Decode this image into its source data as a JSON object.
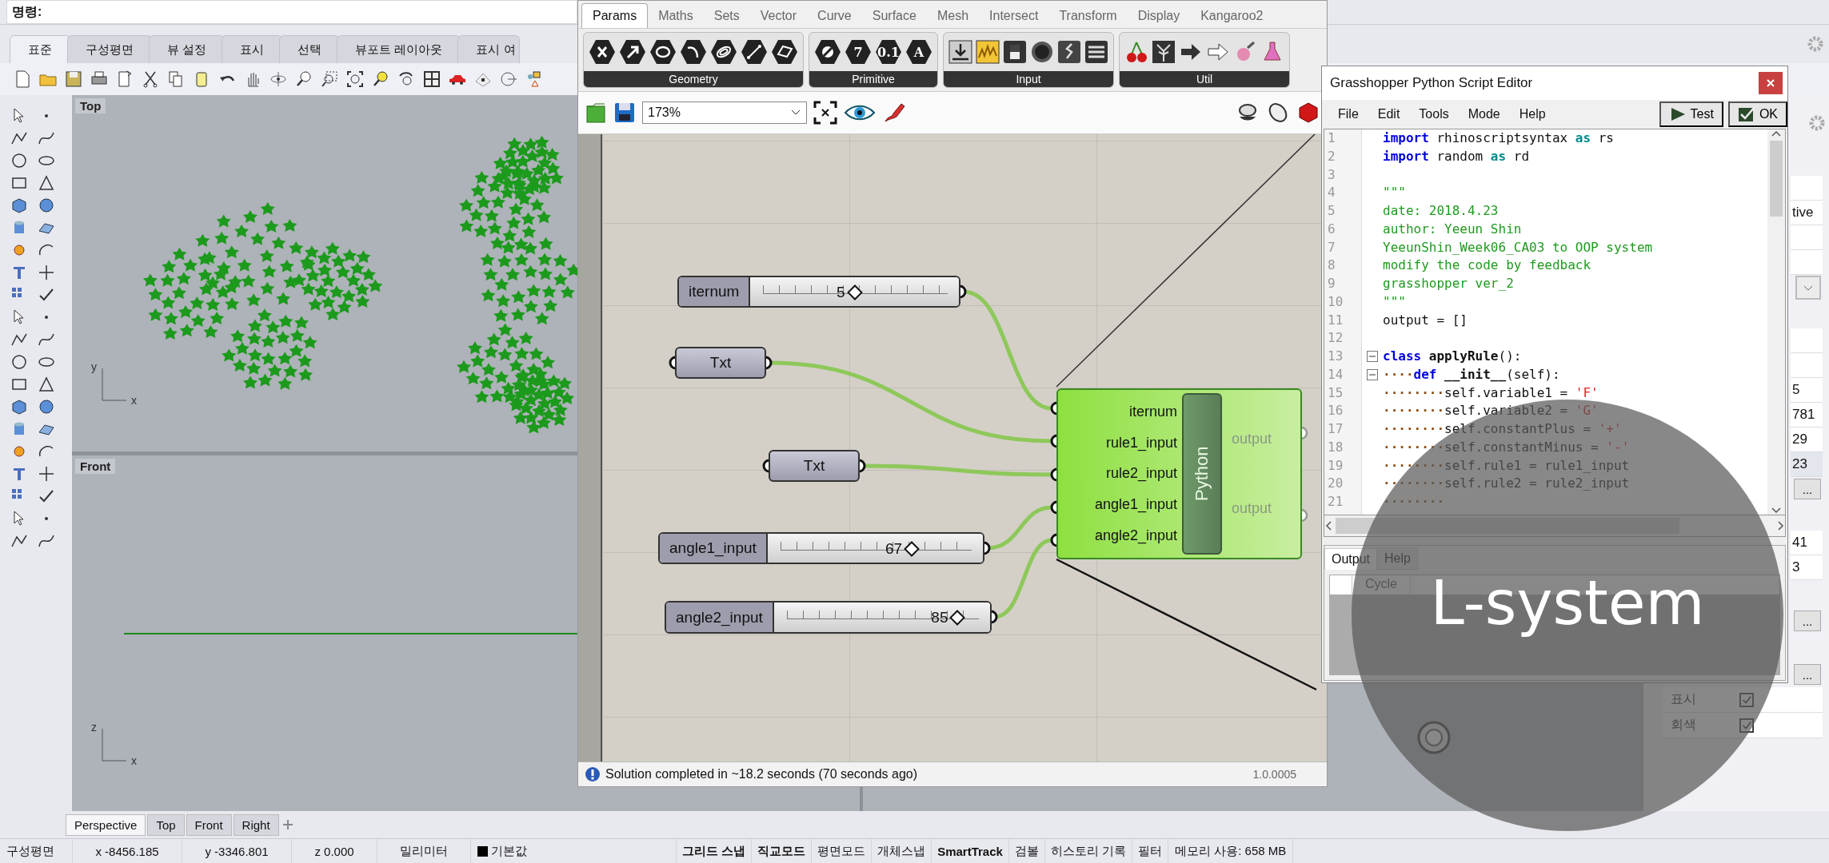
{
  "command_line": {
    "prompt": "명령:"
  },
  "toolbar_tabs": [
    {
      "label": "표준",
      "selected": true
    },
    {
      "label": "구성평면",
      "selected": false
    },
    {
      "label": "뷰 설정",
      "selected": false
    },
    {
      "label": "표시",
      "selected": false
    },
    {
      "label": "선택",
      "selected": false
    },
    {
      "label": "뷰포트 레이아웃",
      "selected": false
    },
    {
      "label": "표시 여",
      "selected": false
    }
  ],
  "viewports": [
    {
      "title": "Top",
      "axes": [
        "y",
        "x"
      ]
    },
    {
      "title": "Front",
      "axes": [
        "z",
        "x"
      ]
    }
  ],
  "viewport_tabs": [
    {
      "label": "Perspective",
      "selected": true
    },
    {
      "label": "Top",
      "selected": false
    },
    {
      "label": "Front",
      "selected": false
    },
    {
      "label": "Right",
      "selected": false
    }
  ],
  "status_bar": {
    "cplane": "구성평면",
    "x": "x -8456.185",
    "y": "y -3346.801",
    "z": "z 0.000",
    "units": "밀리미터",
    "layer": "기본값",
    "toggles": [
      {
        "label": "그리드 스냅",
        "on": true
      },
      {
        "label": "직교모드",
        "on": true
      },
      {
        "label": "평면모드",
        "on": false
      },
      {
        "label": "개체스냅",
        "on": false
      },
      {
        "label": "SmartTrack",
        "on": true
      },
      {
        "label": "검볼",
        "on": false
      },
      {
        "label": "히스토리 기록",
        "on": false
      },
      {
        "label": "필터",
        "on": false
      }
    ],
    "memory": "메모리 사용: 658 MB"
  },
  "properties_panel": {
    "rows": [
      {
        "kind": "blank"
      },
      {
        "kind": "value",
        "value": "tive",
        "selected": false
      },
      {
        "kind": "blank"
      },
      {
        "kind": "blank"
      },
      {
        "kind": "dropdown"
      },
      {
        "kind": "section"
      },
      {
        "kind": "blank"
      },
      {
        "kind": "blank"
      },
      {
        "kind": "value",
        "value": "5",
        "selected": false
      },
      {
        "kind": "value",
        "value": "781",
        "selected": false
      },
      {
        "kind": "value",
        "value": "29",
        "selected": false
      },
      {
        "kind": "value",
        "value": "23",
        "selected": true
      },
      {
        "kind": "button",
        "label": "..."
      },
      {
        "kind": "section"
      },
      {
        "kind": "value",
        "value": "41",
        "selected": false
      },
      {
        "kind": "value",
        "value": "3",
        "selected": false
      },
      {
        "kind": "section"
      },
      {
        "kind": "button",
        "label": "..."
      },
      {
        "kind": "section"
      },
      {
        "kind": "button",
        "label": "..."
      },
      {
        "kind": "check",
        "label": "표시",
        "checked": true
      },
      {
        "kind": "check",
        "label": "회색",
        "checked": true
      }
    ]
  },
  "grasshopper": {
    "tabs": [
      {
        "label": "Params",
        "selected": true
      },
      {
        "label": "Maths",
        "selected": false
      },
      {
        "label": "Sets",
        "selected": false
      },
      {
        "label": "Vector",
        "selected": false
      },
      {
        "label": "Curve",
        "selected": false
      },
      {
        "label": "Surface",
        "selected": false
      },
      {
        "label": "Mesh",
        "selected": false
      },
      {
        "label": "Intersect",
        "selected": false
      },
      {
        "label": "Transform",
        "selected": false
      },
      {
        "label": "Display",
        "selected": false
      },
      {
        "label": "Kangaroo2",
        "selected": false
      }
    ],
    "ribbon_groups": [
      {
        "title": "Geometry"
      },
      {
        "title": "Primitive",
        "glyphs": [
          "7",
          "0.1",
          "A"
        ]
      },
      {
        "title": "Input"
      },
      {
        "title": "Util"
      }
    ],
    "zoom": "173%",
    "sliders": [
      {
        "label": "iternum",
        "value": "5",
        "level": 0.5
      },
      {
        "label": "angle1_input",
        "value": "67",
        "level": 0.67
      },
      {
        "label": "angle2_input",
        "value": "85",
        "level": 0.85
      }
    ],
    "panels": [
      {
        "label": "Txt"
      },
      {
        "label": "Txt"
      }
    ],
    "component": {
      "title": "Python",
      "inputs": [
        "iternum",
        "rule1_input",
        "rule2_input",
        "angle1_input",
        "angle2_input"
      ],
      "outputs": [
        "output",
        "output"
      ]
    },
    "status": "Solution completed in ~18.2 seconds (70 seconds ago)",
    "version": "1.0.0005"
  },
  "script_editor": {
    "title": "Grasshopper Python Script Editor",
    "menu": [
      "File",
      "Edit",
      "Tools",
      "Mode",
      "Help"
    ],
    "buttons": [
      "Test",
      "OK"
    ],
    "code_lines": [
      {
        "number": "1",
        "fold": false,
        "tokens": [
          {
            "kind": "keyword",
            "text": "import"
          },
          {
            "kind": "plain",
            "text": " rhinoscriptsyntax "
          },
          {
            "kind": "operator",
            "text": "as"
          },
          {
            "kind": "plain",
            "text": " rs"
          }
        ]
      },
      {
        "number": "2",
        "fold": false,
        "tokens": [
          {
            "kind": "keyword",
            "text": "import"
          },
          {
            "kind": "plain",
            "text": " random "
          },
          {
            "kind": "operator",
            "text": "as"
          },
          {
            "kind": "plain",
            "text": " rd"
          }
        ]
      },
      {
        "number": "3",
        "fold": false
      },
      {
        "number": "4",
        "fold": false,
        "tokens": [
          {
            "kind": "docstring",
            "text": "\"\"\""
          }
        ]
      },
      {
        "number": "5",
        "fold": false,
        "tokens": [
          {
            "kind": "docstring",
            "text": "date: 2018.4.23"
          }
        ]
      },
      {
        "number": "6",
        "fold": false,
        "tokens": [
          {
            "kind": "docstring",
            "text": "author: Yeeun Shin"
          }
        ]
      },
      {
        "number": "7",
        "fold": false,
        "tokens": [
          {
            "kind": "docstring",
            "text": "YeeunShin_Week06_CA03 to OOP system"
          }
        ]
      },
      {
        "number": "8",
        "fold": false,
        "tokens": [
          {
            "kind": "docstring",
            "text": "modify the code by feedback"
          }
        ]
      },
      {
        "number": "9",
        "fold": false,
        "tokens": [
          {
            "kind": "docstring",
            "text": "grasshopper ver_2"
          }
        ]
      },
      {
        "number": "10",
        "fold": false,
        "tokens": [
          {
            "kind": "docstring",
            "text": "\"\"\""
          }
        ]
      },
      {
        "number": "11",
        "fold": false,
        "tokens": [
          {
            "kind": "plain",
            "text": "output = []"
          }
        ]
      },
      {
        "number": "12",
        "fold": false
      },
      {
        "number": "13",
        "fold": true,
        "tokens": [
          {
            "kind": "keyword",
            "text": "class"
          },
          {
            "kind": "name",
            "text": " applyRule"
          },
          {
            "kind": "plain",
            "text": "():"
          }
        ]
      },
      {
        "number": "14",
        "fold": true,
        "tokens": [
          {
            "kind": "whitespace",
            "text": "····"
          },
          {
            "kind": "keyword",
            "text": "def"
          },
          {
            "kind": "name",
            "text": " __init__"
          },
          {
            "kind": "plain",
            "text": "(self):"
          }
        ]
      },
      {
        "number": "15",
        "fold": false,
        "tokens": [
          {
            "kind": "whitespace",
            "text": "········"
          },
          {
            "kind": "plain",
            "text": "self.variable1 = "
          },
          {
            "kind": "string",
            "text": "'F'"
          }
        ]
      },
      {
        "number": "16",
        "fold": false,
        "tokens": [
          {
            "kind": "whitespace",
            "text": "········"
          },
          {
            "kind": "plain",
            "text": "self.variable2 = "
          },
          {
            "kind": "string",
            "text": "'G'"
          }
        ]
      },
      {
        "number": "17",
        "fold": false,
        "tokens": [
          {
            "kind": "whitespace",
            "text": "········"
          },
          {
            "kind": "plain",
            "text": "self.constantPlus = "
          },
          {
            "kind": "string",
            "text": "'+'"
          }
        ]
      },
      {
        "number": "18",
        "fold": false,
        "tokens": [
          {
            "kind": "whitespace",
            "text": "········"
          },
          {
            "kind": "plain",
            "text": "self.constantMinus = "
          },
          {
            "kind": "string",
            "text": "'-'"
          }
        ]
      },
      {
        "number": "19",
        "fold": false,
        "tokens": [
          {
            "kind": "whitespace",
            "text": "········"
          },
          {
            "kind": "plain",
            "text": "self.rule1 = rule1_input"
          }
        ]
      },
      {
        "number": "20",
        "fold": false,
        "tokens": [
          {
            "kind": "whitespace",
            "text": "········"
          },
          {
            "kind": "plain",
            "text": "self.rule2 = rule2_input"
          }
        ]
      },
      {
        "number": "21",
        "fold": false,
        "tokens": [
          {
            "kind": "whitespace",
            "text": "········"
          }
        ]
      }
    ],
    "output_tabs": [
      {
        "label": "Output",
        "selected": true
      },
      {
        "label": "Help",
        "selected": false
      }
    ],
    "output_columns": [
      "Cycle"
    ]
  },
  "overlay": {
    "caption": "L-system"
  }
}
